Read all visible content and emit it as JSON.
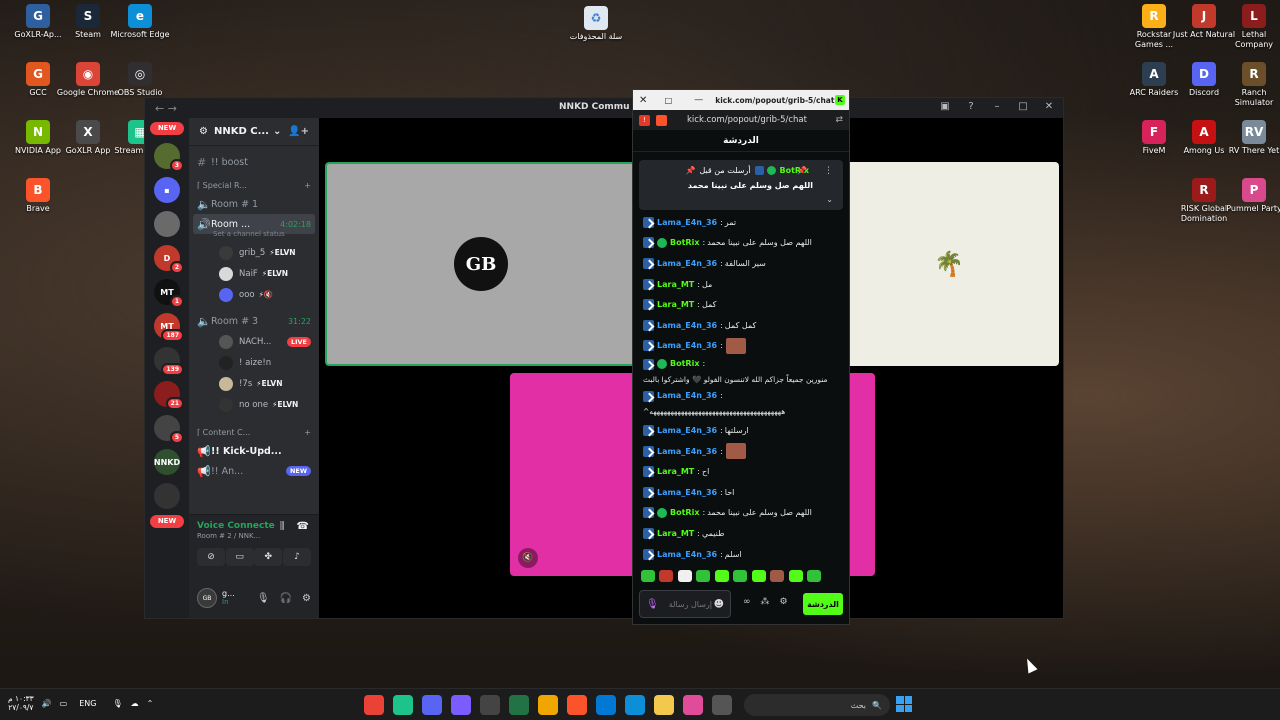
{
  "desktop": {
    "icons_left": [
      {
        "label": "GoXLR-Ap...",
        "color": "#2e5f9e",
        "icon": "goxlr-icon",
        "glyph": "G"
      },
      {
        "label": "Steam",
        "color": "#1b2838",
        "icon": "steam-icon",
        "glyph": "S"
      },
      {
        "label": "Microsoft Edge",
        "color": "#0c8fd6",
        "icon": "edge-icon",
        "glyph": "e"
      },
      {
        "label": "GCC",
        "color": "#e2561f",
        "icon": "gcc-icon",
        "glyph": "G"
      },
      {
        "label": "Google Chrome",
        "color": "#db4437",
        "icon": "chrome-icon",
        "glyph": "◉"
      },
      {
        "label": "OBS Studio",
        "color": "#302e31",
        "icon": "obs-icon",
        "glyph": "◎"
      },
      {
        "label": "NVIDIA App",
        "color": "#76b900",
        "icon": "nvidia-icon",
        "glyph": "N"
      },
      {
        "label": "GoXLR App",
        "color": "#4a4a4a",
        "icon": "goxlr-app-icon",
        "glyph": "X"
      },
      {
        "label": "Stream Desk",
        "color": "#1ec28b",
        "icon": "stream-deck-icon",
        "glyph": "▦"
      },
      {
        "label": "Brave",
        "color": "#fb542b",
        "icon": "brave-icon",
        "glyph": "B"
      }
    ],
    "recycle_bin": {
      "label": "سلة المحذوفات",
      "icon": "recycle-bin-icon"
    },
    "icons_right": [
      {
        "label": "Rockstar Games ...",
        "color": "#fcaf17",
        "icon": "rockstar-icon",
        "glyph": "R"
      },
      {
        "label": "Just Act Natural",
        "color": "#c0392b",
        "icon": "just-act-natural-icon",
        "glyph": "J"
      },
      {
        "label": "Lethal Company",
        "color": "#8b1d1d",
        "icon": "lethal-company-icon",
        "glyph": "L"
      },
      {
        "label": "ARC Raiders",
        "color": "#2c3e50",
        "icon": "arc-raiders-icon",
        "glyph": "A"
      },
      {
        "label": "Discord",
        "color": "#5865f2",
        "icon": "discord-icon",
        "glyph": "D"
      },
      {
        "label": "Ranch Simulator",
        "color": "#6b4f2a",
        "icon": "ranch-simulator-icon",
        "glyph": "R"
      },
      {
        "label": "FiveM",
        "color": "#d6235a",
        "icon": "fivem-icon",
        "glyph": "F"
      },
      {
        "label": "Among Us",
        "color": "#c51111",
        "icon": "among-us-icon",
        "glyph": "A"
      },
      {
        "label": "RV There Yet",
        "color": "#7a8a99",
        "icon": "rv-there-yet-icon",
        "glyph": "RV"
      },
      {
        "label": "RISK Global Domination",
        "color": "#9b1b1b",
        "icon": "risk-icon",
        "glyph": "R"
      },
      {
        "label": "Pummel Party",
        "color": "#d94a8c",
        "icon": "pummel-party-icon",
        "glyph": "P"
      }
    ]
  },
  "discord": {
    "window_title": "NNKD Commu",
    "guild_name": "NNKD C...",
    "new_label": "NEW",
    "servers": [
      {
        "badge": "3",
        "color": "#556b2f",
        "glyph": "",
        "icon": "server-icon"
      },
      {
        "badge": "",
        "color": "#5865f2",
        "glyph": "▪",
        "icon": "folder-icon"
      },
      {
        "badge": "",
        "color": "#6a6a6a",
        "glyph": "",
        "icon": "server-icon"
      },
      {
        "badge": "2",
        "color": "#c0392b",
        "glyph": "D",
        "icon": "server-icon"
      },
      {
        "badge": "1",
        "color": "#111111",
        "glyph": "MT",
        "icon": "server-icon"
      },
      {
        "badge": "187",
        "color": "#c0392b",
        "glyph": "MT",
        "icon": "server-icon"
      },
      {
        "badge": "139",
        "color": "#333333",
        "glyph": "",
        "icon": "server-icon"
      },
      {
        "badge": "21",
        "color": "#8b1d1d",
        "glyph": "",
        "icon": "server-icon"
      },
      {
        "badge": "5",
        "color": "#444444",
        "glyph": "",
        "icon": "server-icon"
      },
      {
        "badge": "",
        "color": "#2f4f2f",
        "glyph": "NNKD",
        "icon": "server-icon"
      },
      {
        "badge": "",
        "color": "#333333",
        "glyph": "",
        "icon": "server-icon"
      }
    ],
    "channels": {
      "boost": "!! boost",
      "special_cat": "⌈ Special R...",
      "room1": "Room # 1",
      "room2": "Room ...",
      "room2_time": "4:02:18",
      "room2_status": "Set a channel status",
      "room2_users": [
        {
          "name": "grib_5",
          "tag": "⚡ELVN",
          "color": "#3a3a3a"
        },
        {
          "name": "NaiF",
          "tag": "⚡ELVN",
          "color": "#d9d9d9"
        },
        {
          "name": "ooo",
          "tag": "⚡🔇",
          "color": "#5865f2"
        }
      ],
      "room3": "Room # 3",
      "room3_time": "31:22",
      "room3_users": [
        {
          "name": "NACH...",
          "tag": "LIVE",
          "color": "#555555"
        },
        {
          "name": "! aize!n",
          "tag": "",
          "color": "#222222"
        },
        {
          "name": "!7s",
          "tag": "⚡ELVN",
          "color": "#c8b89a"
        },
        {
          "name": "no one",
          "tag": "⚡ELVN",
          "color": "#333333"
        }
      ],
      "content_cat": "⌈ Content C...",
      "kick_updates": "!! Kick-Upd...",
      "an": "!! An...",
      "new_tag": "NEW"
    },
    "voice": {
      "status": "Voice Connecte",
      "room": "Room # 2 / NNK..."
    },
    "user": {
      "avatar_text": "GB",
      "name": "g...",
      "status": "In"
    },
    "tile_logo_gb": "GB",
    "tile_logo_ksa": "🌴"
  },
  "kick": {
    "title": "kick.com/popout/grib-5/chat...",
    "url": "kick.com/popout/grib-5/chat",
    "header": "الدردشة",
    "pinned_by": "أرسلت من قبل",
    "pinned_user": "BotRix",
    "pinned_msg": "اللهم صل وسلم على نبينا محمد",
    "messages": [
      {
        "user": "Lama_E4n_36",
        "color": "#3aa0ff",
        "text": "تمر",
        "verified": false,
        "emote": false
      },
      {
        "user": "BotRix",
        "color": "#53fc18",
        "text": "اللهم صل وسلم على نبينا محمد",
        "verified": true,
        "emote": false
      },
      {
        "user": "Lama_E4n_36",
        "color": "#3aa0ff",
        "text": "سير السالفة",
        "verified": false,
        "emote": false
      },
      {
        "user": "Lara_MT",
        "color": "#53fc18",
        "text": "مل",
        "verified": false,
        "emote": false
      },
      {
        "user": "Lara_MT",
        "color": "#53fc18",
        "text": "كمل",
        "verified": false,
        "emote": false
      },
      {
        "user": "Lama_E4n_36",
        "color": "#3aa0ff",
        "text": "كمل كمل",
        "verified": false,
        "emote": false
      },
      {
        "user": "Lama_E4n_36",
        "color": "#3aa0ff",
        "text": "",
        "verified": false,
        "emote": true
      },
      {
        "user": "BotRix",
        "color": "#53fc18",
        "text": "منورين جميعاً جزاكم الله لاتنسون الفولو 🖤 واشتركوا بالبث",
        "verified": true,
        "emote": false,
        "tall": true
      },
      {
        "user": "Lama_E4n_36",
        "color": "#3aa0ff",
        "text": "^ههههههههههههههههههههههههههههههههههههههه",
        "verified": false,
        "emote": false,
        "tall": true
      },
      {
        "user": "Lama_E4n_36",
        "color": "#3aa0ff",
        "text": "ارسلتها",
        "verified": false,
        "emote": false
      },
      {
        "user": "Lama_E4n_36",
        "color": "#3aa0ff",
        "text": "",
        "verified": false,
        "emote": true
      },
      {
        "user": "Lara_MT",
        "color": "#53fc18",
        "text": "اح",
        "verified": false,
        "emote": false
      },
      {
        "user": "Lama_E4n_36",
        "color": "#3aa0ff",
        "text": "احا",
        "verified": false,
        "emote": false
      },
      {
        "user": "BotRix",
        "color": "#53fc18",
        "text": "اللهم صل وسلم على نبينا محمد",
        "verified": true,
        "emote": false
      },
      {
        "user": "Lara_MT",
        "color": "#53fc18",
        "text": "طنيمي",
        "verified": false,
        "emote": false
      },
      {
        "user": "Lama_E4n_36",
        "color": "#3aa0ff",
        "text": "اسلم",
        "verified": false,
        "emote": false
      }
    ],
    "emotes": [
      "#32c23a",
      "#c0392b",
      "#f0f0f0",
      "#32c23a",
      "#53fc18",
      "#32c23a",
      "#53fc18",
      "#a05a45",
      "#53fc18",
      "#32c23a"
    ],
    "input_placeholder": "إرسال رسالة",
    "send_label": "الدردشة"
  },
  "taskbar": {
    "time": "١٠:٣٣ م",
    "date": "٢٧/٠٩/٧",
    "lang": "ENG",
    "search_label": "بحث",
    "apps": [
      "#ea4335",
      "#1ec28b",
      "#5865f2",
      "#7b5cff",
      "#444444",
      "#217346",
      "#f0a500",
      "#fb542b",
      "#0078d4",
      "#0c8fd6",
      "#f2c94c",
      "#e04b9a",
      "#555555"
    ]
  }
}
